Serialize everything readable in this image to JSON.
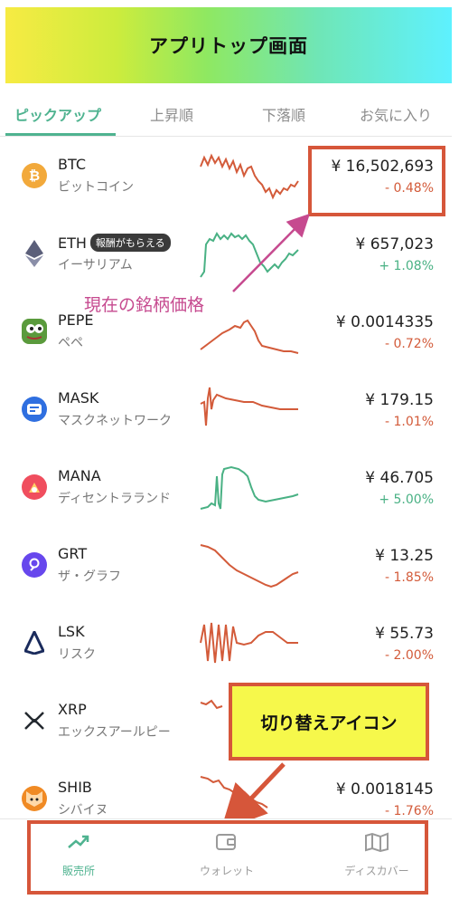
{
  "header": {
    "title": "アプリトップ画面"
  },
  "tabs": [
    {
      "label": "ピックアップ",
      "active": true
    },
    {
      "label": "上昇順",
      "active": false
    },
    {
      "label": "下落順",
      "active": false
    },
    {
      "label": "お気に入り",
      "active": false
    }
  ],
  "coins": [
    {
      "symbol": "BTC",
      "name": "ビットコイン",
      "price": "¥ 16,502,693",
      "change": "- 0.48%",
      "direction": "down",
      "icon": "bitcoin-icon",
      "color": "#f2a93b",
      "badge": ""
    },
    {
      "symbol": "ETH",
      "name": "イーサリアム",
      "price": "¥ 657,023",
      "change": "+ 1.08%",
      "direction": "up",
      "icon": "ethereum-icon",
      "color": "#5b5f7a",
      "badge": "報酬がもらえる"
    },
    {
      "symbol": "PEPE",
      "name": "ペペ",
      "price": "¥ 0.0014335",
      "change": "- 0.72%",
      "direction": "down",
      "icon": "pepe-frog-icon",
      "color": "#5a9a3c",
      "badge": ""
    },
    {
      "symbol": "MASK",
      "name": "マスクネットワーク",
      "price": "¥ 179.15",
      "change": "- 1.01%",
      "direction": "down",
      "icon": "mask-icon",
      "color": "#2f6fe0",
      "badge": ""
    },
    {
      "symbol": "MANA",
      "name": "ディセントラランド",
      "price": "¥ 46.705",
      "change": "+ 5.00%",
      "direction": "up",
      "icon": "mana-icon",
      "color": "#f04e5e",
      "badge": ""
    },
    {
      "symbol": "GRT",
      "name": "ザ・グラフ",
      "price": "¥ 13.25",
      "change": "- 1.85%",
      "direction": "down",
      "icon": "graph-icon",
      "color": "#6747ed",
      "badge": ""
    },
    {
      "symbol": "LSK",
      "name": "リスク",
      "price": "¥ 55.73",
      "change": "- 2.00%",
      "direction": "down",
      "icon": "lisk-icon",
      "color": "#1a2b5c",
      "badge": ""
    },
    {
      "symbol": "XRP",
      "name": "エックスアールピー",
      "price": "",
      "change": "",
      "direction": "down",
      "icon": "xrp-icon",
      "color": "#23292f",
      "badge": ""
    },
    {
      "symbol": "SHIB",
      "name": "シバイヌ",
      "price": "¥ 0.0018145",
      "change": "- 1.76%",
      "direction": "down",
      "icon": "shiba-icon",
      "color": "#f08a24",
      "badge": ""
    }
  ],
  "annotations": {
    "price_label": "現在の銘柄価格",
    "switch_label": "切り替えアイコン"
  },
  "bottom_nav": [
    {
      "label": "販売所",
      "icon": "trend-up-icon",
      "active": true
    },
    {
      "label": "ウォレット",
      "icon": "wallet-icon",
      "active": false
    },
    {
      "label": "ディスカバー",
      "icon": "map-icon",
      "active": false
    }
  ],
  "colors": {
    "accent": "#4fb390",
    "negative": "#d35b3a",
    "positive": "#49b184",
    "annotation": "#d6563a",
    "annotation_text": "#c64a8f"
  }
}
